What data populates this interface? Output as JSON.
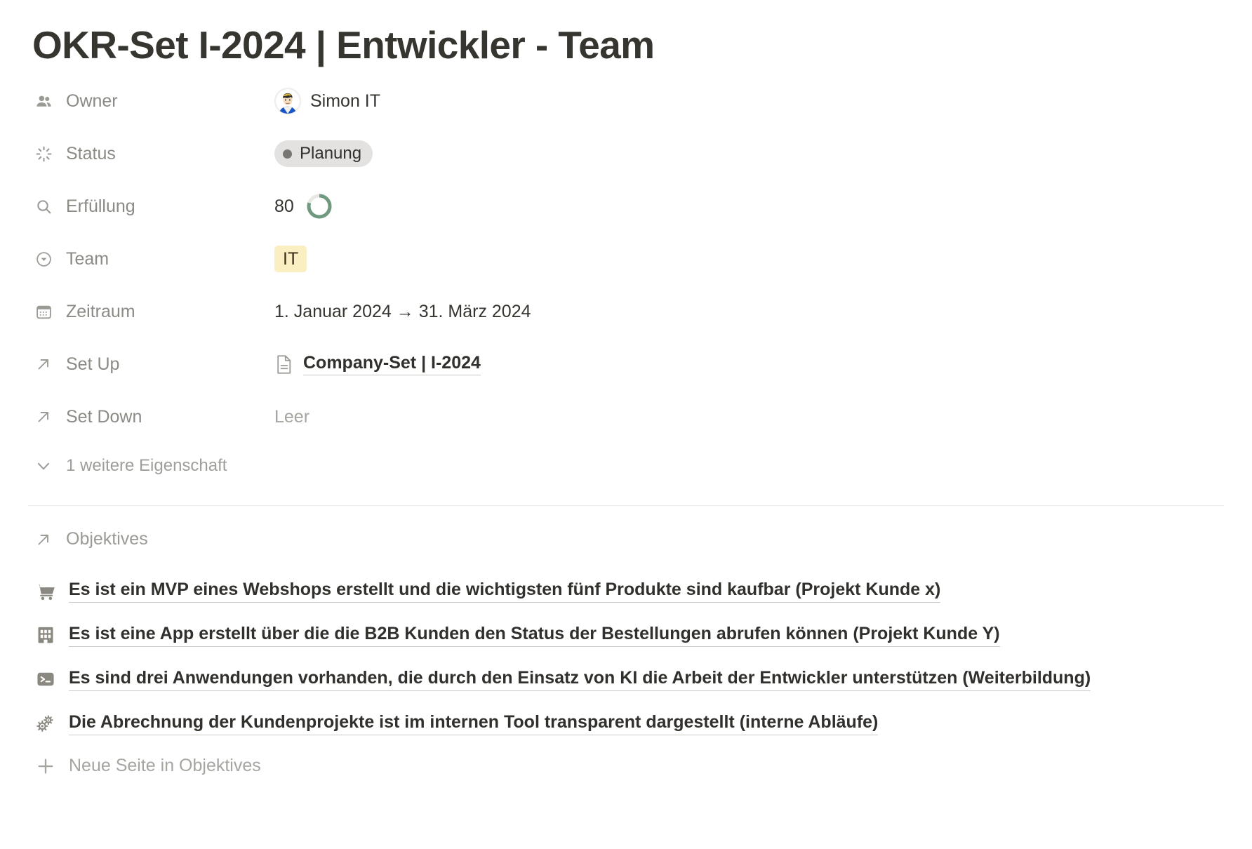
{
  "page": {
    "title": "OKR-Set I-2024 | Entwickler - Team"
  },
  "properties": [
    {
      "icon": "people-icon",
      "label": "Owner",
      "type": "person",
      "value": "Simon IT"
    },
    {
      "icon": "spinner-icon",
      "label": "Status",
      "type": "status",
      "value": "Planung",
      "dot_color": "#787774",
      "pill_color": "#e3e2e0"
    },
    {
      "icon": "search-icon",
      "label": "Erfüllung",
      "type": "progress",
      "value": "80",
      "percent": 80,
      "ring_color": "#6f9a80",
      "track_color": "#e9e8e4"
    },
    {
      "icon": "select-icon",
      "label": "Team",
      "type": "tag",
      "value": "IT",
      "tag_color": "#faeec3"
    },
    {
      "icon": "calendar-icon",
      "label": "Zeitraum",
      "type": "date-range",
      "value": "1. Januar 2024 → 31. März 2024"
    },
    {
      "icon": "arrow-up-right-icon",
      "label": "Set Up",
      "type": "relation",
      "value": "Company-Set | I-2024"
    },
    {
      "icon": "arrow-up-right-icon",
      "label": "Set Down",
      "type": "relation-empty",
      "value": "Leer"
    }
  ],
  "more_properties": {
    "icon": "chevron-down-icon",
    "label": "1 weitere Eigenschaft"
  },
  "objectives_section": {
    "icon": "arrow-up-right-icon",
    "label": "Objektives",
    "items": [
      {
        "icon": "shopping-cart-icon",
        "text": "Es ist ein MVP eines Webshops erstellt und die wichtigsten fünf Produkte sind kaufbar (Projekt Kunde x)"
      },
      {
        "icon": "bank-building-icon",
        "text": "Es ist eine App erstellt über die die B2B Kunden den Status der Bestellungen abrufen können (Projekt Kunde Y)"
      },
      {
        "icon": "terminal-icon",
        "text": "Es sind drei Anwendungen vorhanden, die durch den Einsatz von KI die Arbeit der Entwickler unterstützen (Weiterbildung)"
      },
      {
        "icon": "gears-icon",
        "text": "Die Abrechnung der Kundenprojekte ist im internen Tool transparent dargestellt (interne Abläufe)"
      }
    ],
    "new_page": {
      "icon": "plus-icon",
      "label": "Neue Seite in Objektives"
    }
  }
}
